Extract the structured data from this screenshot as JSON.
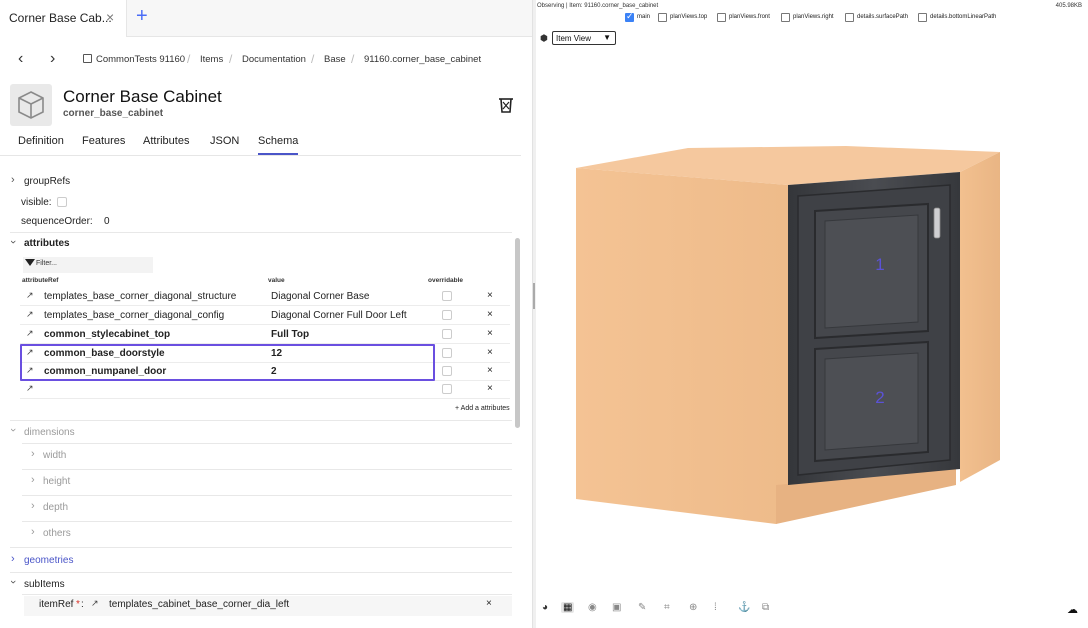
{
  "tabbar": {
    "tab_label": "Corner Base Cab...",
    "close": "×",
    "new_tab": "+"
  },
  "breadcrumb": {
    "back": "‹",
    "forward": "›",
    "items": [
      "CommonTests 91160",
      "Items",
      "Documentation",
      "Base",
      "91160.corner_base_cabinet"
    ]
  },
  "item": {
    "title": "Corner Base Cabinet",
    "subtitle": "corner_base_cabinet"
  },
  "subtabs": [
    "Definition",
    "Features",
    "Attributes",
    "JSON",
    "Schema"
  ],
  "active_subtab": "Schema",
  "schema": {
    "groupRefs": "groupRefs",
    "visible_label": "visible:",
    "sequenceOrder_label": "sequenceOrder:",
    "sequenceOrder_value": "0",
    "attributes_label": "attributes",
    "filter_placeholder": "Filter...",
    "columns": {
      "ref": "attributeRef",
      "value": "value",
      "overridable": "overridable"
    },
    "rows": [
      {
        "ref": "templates_base_corner_diagonal_structure",
        "value": "Diagonal Corner Base",
        "bold": false
      },
      {
        "ref": "templates_base_corner_diagonal_config",
        "value": "Diagonal Corner Full Door Left",
        "bold": false
      },
      {
        "ref": "common_stylecabinet_top",
        "value": "Full Top",
        "bold": true
      },
      {
        "ref": "common_base_doorstyle",
        "value": "12",
        "bold": true
      },
      {
        "ref": "common_numpanel_door",
        "value": "2",
        "bold": true
      },
      {
        "ref": "",
        "value": "",
        "bold": false
      }
    ],
    "remove_symbol": "×",
    "add_attribute": "+ Add a attributes",
    "dimensions_label": "dimensions",
    "dimension_children": [
      "width",
      "height",
      "depth",
      "others"
    ],
    "geometries_label": "geometries",
    "subItems_label": "subItems",
    "itemRef_label": "itemRef",
    "itemRef_required": "*",
    "itemRef_colon": ":",
    "itemRef_value": "templates_cabinet_base_corner_dia_left"
  },
  "viewer": {
    "observing": "Observing | Item: 91160.corner_base_cabinet",
    "filesize": "405.98KB",
    "views": [
      {
        "label": "main",
        "checked": true
      },
      {
        "label": "planViews.top",
        "checked": false
      },
      {
        "label": "planViews.front",
        "checked": false
      },
      {
        "label": "planViews.right",
        "checked": false
      },
      {
        "label": "details.surfacePath",
        "checked": false
      },
      {
        "label": "details.bottomLinearPath",
        "checked": false
      }
    ],
    "view_select": "Item View",
    "panel_labels": [
      "1",
      "2"
    ]
  },
  "colors": {
    "accent": "#4a55c8",
    "highlight": "#6a4fe0",
    "cabinet_side": "#f0bf8f",
    "cabinet_top": "#f2c59a",
    "door": "#3d3f44"
  }
}
